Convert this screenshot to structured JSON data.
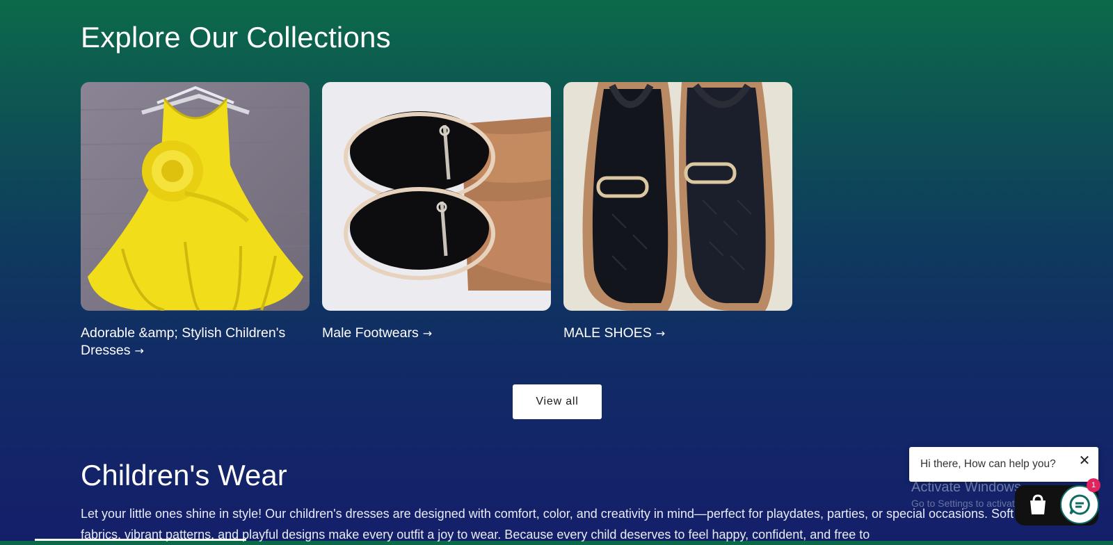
{
  "collections": {
    "title": "Explore Our Collections",
    "cards": [
      {
        "label": "Adorable &amp; Stylish Children's Dresses",
        "arrow": "→",
        "image": "yellow-dress-photo"
      },
      {
        "label": "Male Footwears",
        "arrow": "→",
        "image": "black-loafers-feet-photo"
      },
      {
        "label": "MALE SHOES",
        "arrow": "→",
        "image": "black-monogram-loafers-photo"
      }
    ],
    "view_all_label": "View all"
  },
  "childrens_wear": {
    "title": "Children's Wear",
    "description": "Let your little ones shine in style! Our children's dresses are designed with comfort, color, and creativity in mind—perfect for playdates, parties, or special occasions. Soft fabrics, vibrant patterns, and playful designs make every outfit a joy to wear. Because every child deserves to feel happy, confident, and free to"
  },
  "chat_widget": {
    "greeting": "Hi there, How can help you?",
    "close_symbol": "✕",
    "badge_count": "1"
  },
  "os_watermark": {
    "title": "Activate Windows",
    "subtitle": "Go to Settings to activate Windows."
  },
  "colors": {
    "gradient_top": "#0c6a4a",
    "gradient_bottom": "#141f6a",
    "button_bg": "#ffffff",
    "badge": "#e0245e",
    "chat_accent": "#0f6b63"
  }
}
